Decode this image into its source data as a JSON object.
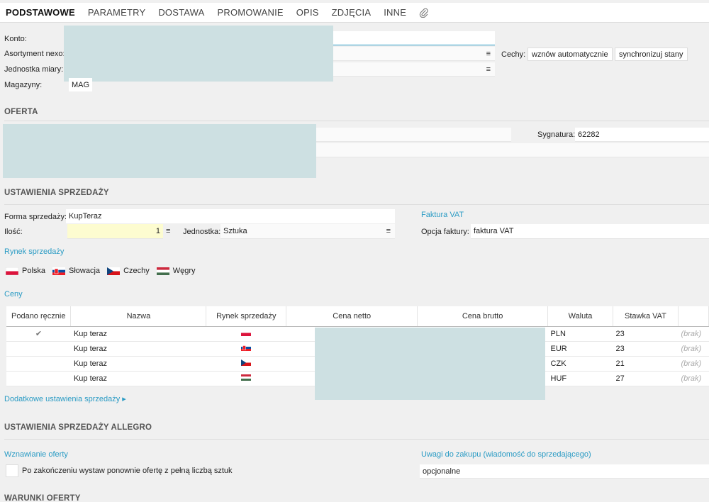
{
  "tabs": [
    "PODSTAWOWE",
    "PARAMETRY",
    "DOSTAWA",
    "PROMOWANIE",
    "OPIS",
    "ZDJĘCIA",
    "INNE"
  ],
  "basic": {
    "konto_label": "Konto:",
    "asortyment_label": "Asortyment nexo:",
    "jednostka_label": "Jednostka miary:",
    "magazyny_label": "Magazyny:",
    "magazyny_value": "MAG",
    "cechy_label": "Cechy:",
    "cechy_btn1": "wznów automatycznie",
    "cechy_btn2": "synchronizuj stany"
  },
  "oferta": {
    "title": "OFERTA",
    "sygnatura_label": "Sygnatura:",
    "sygnatura_value": "62282"
  },
  "sprzedaz": {
    "title": "USTAWIENIA SPRZEDAŻY",
    "forma_label": "Forma sprzedaży:",
    "forma_value": "KupTeraz",
    "ilosc_label": "Ilość:",
    "ilosc_value": "1",
    "jednostka_label": "Jednostka:",
    "jednostka_value": "Sztuka",
    "faktura_link": "Faktura VAT",
    "opcja_label": "Opcja faktury:",
    "opcja_value": "faktura VAT",
    "rynek_link": "Rynek sprzedaży",
    "markets": [
      {
        "name": "Polska",
        "flag": "pl"
      },
      {
        "name": "Słowacja",
        "flag": "sk"
      },
      {
        "name": "Czechy",
        "flag": "cz"
      },
      {
        "name": "Węgry",
        "flag": "hu"
      }
    ],
    "ceny_link": "Ceny",
    "columns": [
      "Podano ręcznie",
      "Nazwa",
      "Rynek sprzedaży",
      "Cena netto",
      "Cena brutto",
      "Waluta",
      "Stawka VAT"
    ],
    "rows": [
      {
        "manual": "✔",
        "name": "Kup teraz",
        "flag": "pl",
        "currency": "PLN",
        "vat": "23",
        "extra": "(brak)"
      },
      {
        "manual": "",
        "name": "Kup teraz",
        "flag": "sk",
        "currency": "EUR",
        "vat": "23",
        "extra": "(brak)"
      },
      {
        "manual": "",
        "name": "Kup teraz",
        "flag": "cz",
        "currency": "CZK",
        "vat": "21",
        "extra": "(brak)"
      },
      {
        "manual": "",
        "name": "Kup teraz",
        "flag": "hu",
        "currency": "HUF",
        "vat": "27",
        "extra": "(brak)"
      }
    ],
    "dodatkowe_link": "Dodatkowe ustawienia sprzedaży ▸"
  },
  "allegro": {
    "title": "USTAWIENIA SPRZEDAŻY ALLEGRO",
    "wznawianie_link": "Wznawianie oferty",
    "wznawianie_text": "Po zakończeniu wystaw ponownie ofertę z pełną liczbą sztuk",
    "uwagi_link": "Uwagi do zakupu (wiadomość do sprzedającego)",
    "uwagi_value": "opcjonalne"
  },
  "warunki": {
    "title": "WARUNKI OFERTY"
  },
  "icons": {
    "menu": "≡",
    "paperclip": "paperclip-icon"
  }
}
